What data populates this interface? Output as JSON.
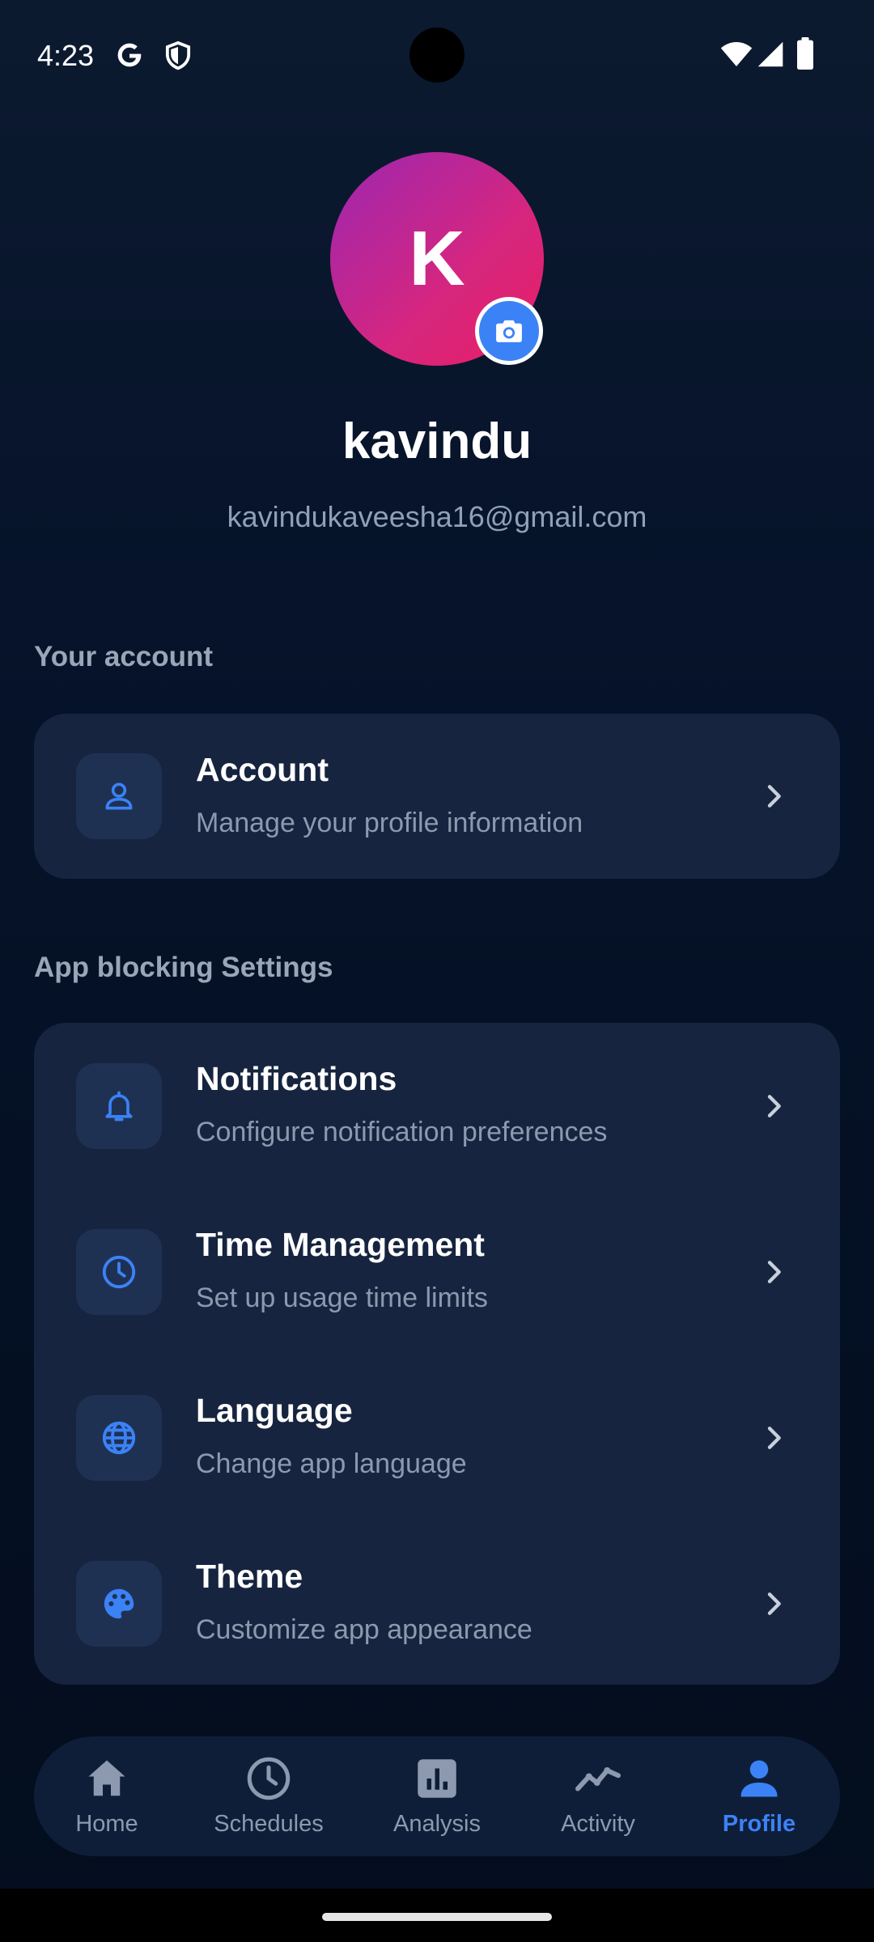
{
  "status_bar": {
    "time": "4:23"
  },
  "profile": {
    "avatar_letter": "K",
    "name": "kavindu",
    "email": "kavindukaveesha16@gmail.com"
  },
  "sections": {
    "account_title": "Your account",
    "blocking_title": "App blocking Settings"
  },
  "account_item": {
    "title": "Account",
    "subtitle": "Manage your profile information",
    "icon": "person-icon"
  },
  "settings_items": [
    {
      "title": "Notifications",
      "subtitle": "Configure notification preferences",
      "icon": "bell-icon"
    },
    {
      "title": "Time Management",
      "subtitle": "Set up usage time limits",
      "icon": "clock-icon"
    },
    {
      "title": "Language",
      "subtitle": "Change app language",
      "icon": "globe-icon"
    },
    {
      "title": "Theme",
      "subtitle": "Customize app appearance",
      "icon": "palette-icon"
    }
  ],
  "bottom_nav": {
    "active": "Profile",
    "items": [
      {
        "label": "Home",
        "icon": "home-icon"
      },
      {
        "label": "Schedules",
        "icon": "clock-icon"
      },
      {
        "label": "Analysis",
        "icon": "bar-chart-icon"
      },
      {
        "label": "Activity",
        "icon": "trend-line-icon"
      },
      {
        "label": "Profile",
        "icon": "person-icon"
      }
    ]
  },
  "colors": {
    "accent": "#3b82f6",
    "background": "#06132a",
    "card": "#16243f",
    "avatar_gradient_start": "#9c27b0",
    "avatar_gradient_end": "#e91e63"
  }
}
